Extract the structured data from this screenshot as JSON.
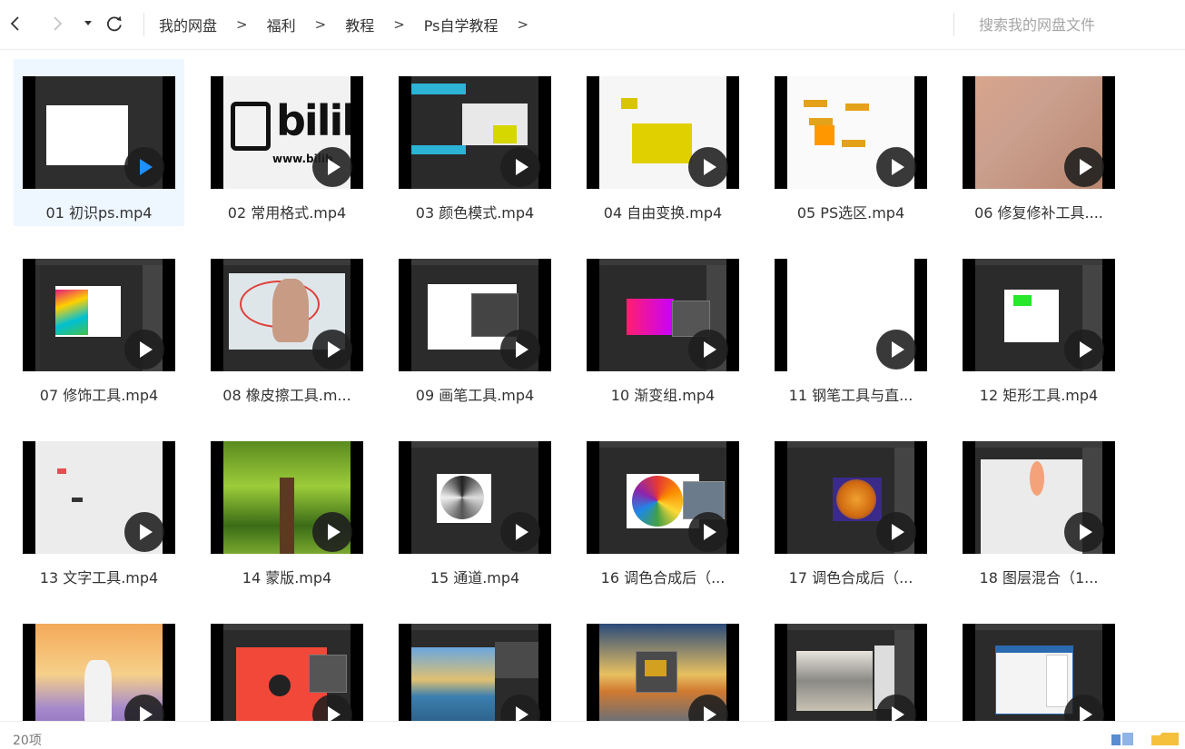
{
  "nav": {
    "crumbs": [
      "我的网盘",
      "福利",
      "教程",
      "Ps自学教程"
    ],
    "separator": ">"
  },
  "search": {
    "placeholder": "搜索我的网盘文件"
  },
  "files": [
    {
      "name": "01 初识ps.mp4",
      "selected": true
    },
    {
      "name": "02 常用格式.mp4"
    },
    {
      "name": "03 颜色模式.mp4"
    },
    {
      "name": "04 自由变换.mp4"
    },
    {
      "name": "05 PS选区.mp4"
    },
    {
      "name": "06 修复修补工具...."
    },
    {
      "name": "07  修饰工具.mp4"
    },
    {
      "name": "08 橡皮擦工具.m..."
    },
    {
      "name": "09 画笔工具.mp4"
    },
    {
      "name": "10 渐变组.mp4"
    },
    {
      "name": "11 钢笔工具与直..."
    },
    {
      "name": "12 矩形工具.mp4"
    },
    {
      "name": "13  文字工具.mp4"
    },
    {
      "name": "14 蒙版.mp4"
    },
    {
      "name": "15 通道.mp4"
    },
    {
      "name": "16 调色合成后（..."
    },
    {
      "name": "17 调色合成后（..."
    },
    {
      "name": "18 图层混合（1..."
    },
    {
      "name": ""
    },
    {
      "name": ""
    },
    {
      "name": ""
    },
    {
      "name": ""
    },
    {
      "name": ""
    },
    {
      "name": ""
    }
  ],
  "thumb_text": {
    "bili": "bilib",
    "url": "www.bilib"
  },
  "status": {
    "count": "20项"
  },
  "colors": {
    "accent": "#1e90ff",
    "selected_bg": "#eef6ff",
    "folder": "#f5c13c"
  }
}
